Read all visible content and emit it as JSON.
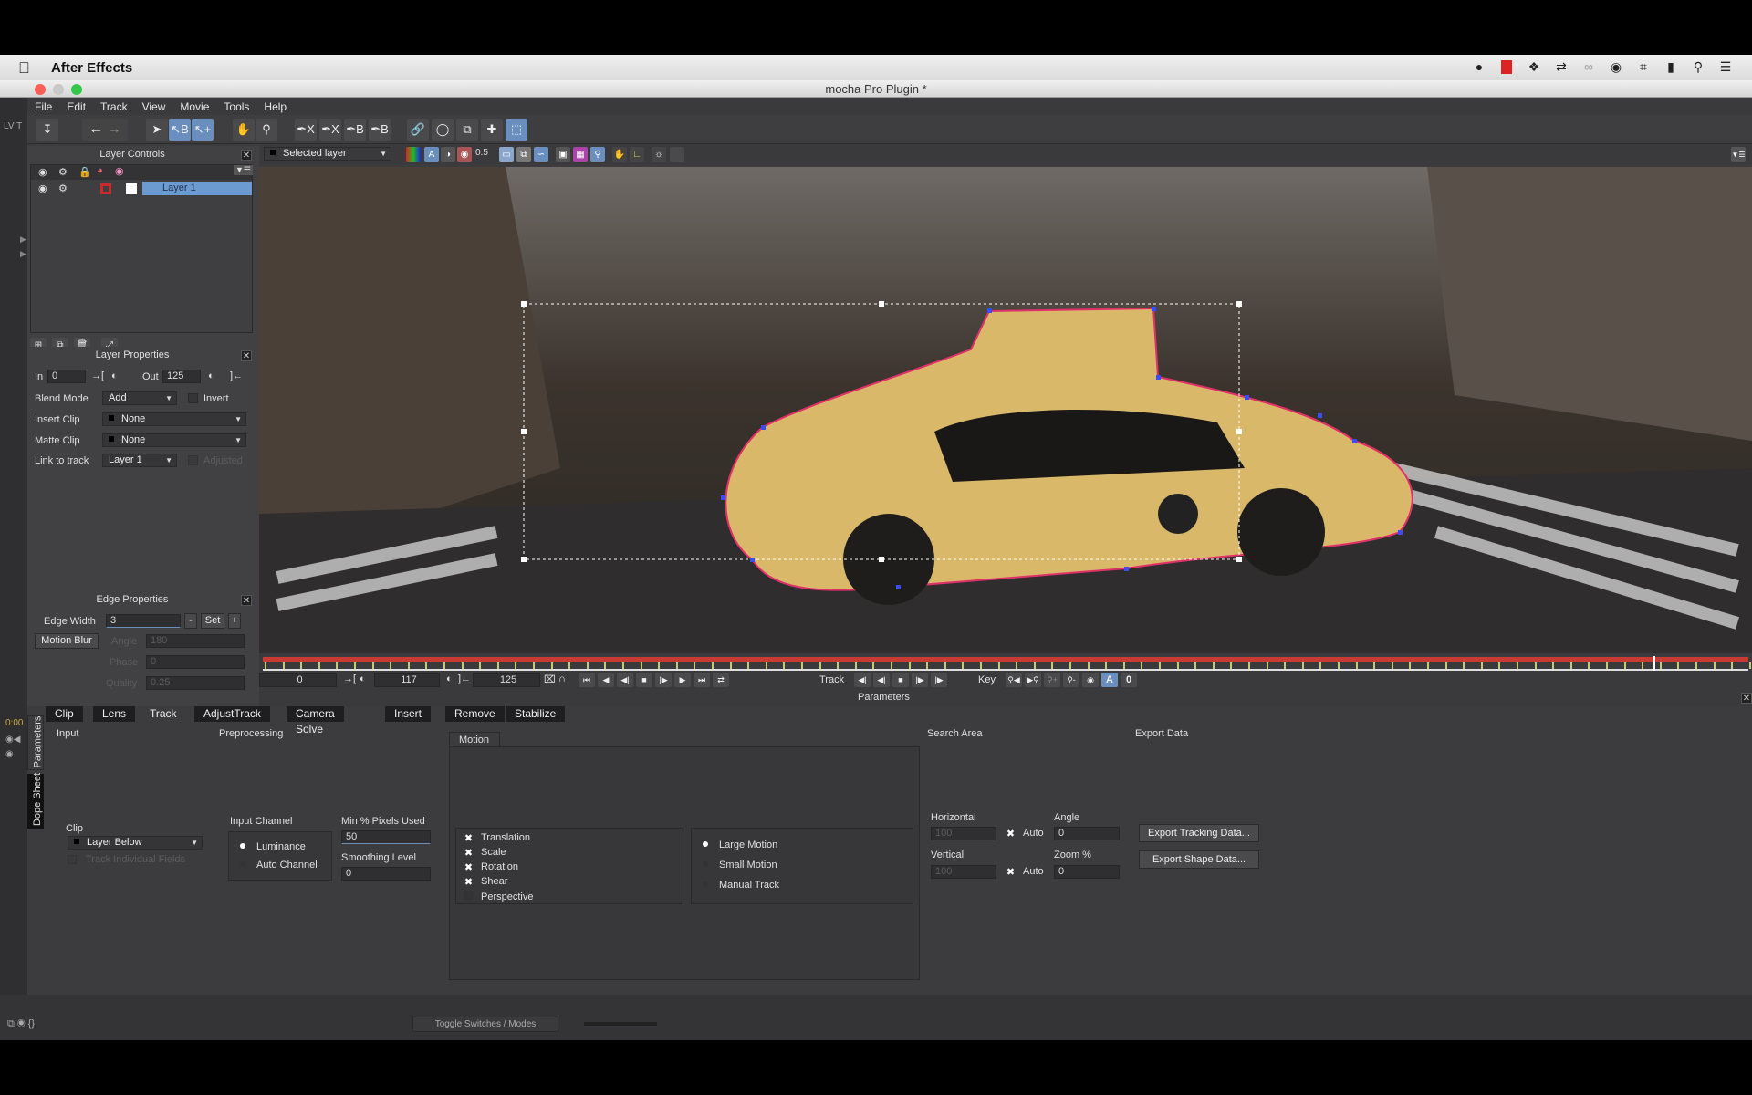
{
  "mac_menubar": {
    "app_name": "After Effects",
    "tray_icons": [
      "notification-icon",
      "record-icon",
      "dropbox-icon",
      "sync-icon",
      "creative-cloud-icon",
      "target-icon",
      "wifi-icon",
      "battery-icon",
      "spotlight-icon",
      "list-icon"
    ]
  },
  "window": {
    "title": "mocha Pro Plugin *",
    "ae_left_label": "LV T"
  },
  "menu": [
    "File",
    "Edit",
    "Track",
    "View",
    "Movie",
    "Tools",
    "Help"
  ],
  "toolbar": {
    "tools": [
      "save-icon",
      "undo-icon",
      "redo-icon",
      "pick-icon",
      "select-b-icon",
      "add-point-icon",
      "hand-icon",
      "zoom-icon",
      "xspline-icon",
      "xspline-add-icon",
      "bezier-icon",
      "bezier-add-icon",
      "link-icon",
      "lasso-icon",
      "transform-icon",
      "move-icon",
      "surface-icon"
    ]
  },
  "viewer_bar": {
    "layer_select": "Selected layer",
    "opacity": "0.5"
  },
  "layer_controls": {
    "title": "Layer Controls",
    "layers": [
      {
        "name": "Layer 1",
        "color": "#cc2a2a"
      }
    ]
  },
  "layer_properties": {
    "title": "Layer Properties",
    "in_label": "In",
    "in_value": "0",
    "out_label": "Out",
    "out_value": "125",
    "blend_mode_label": "Blend Mode",
    "blend_mode": "Add",
    "invert_label": "Invert",
    "insert_clip_label": "Insert Clip",
    "insert_clip": "None",
    "matte_clip_label": "Matte Clip",
    "matte_clip": "None",
    "link_to_track_label": "Link to track",
    "link_to_track": "Layer 1",
    "adjusted_label": "Adjusted"
  },
  "edge_properties": {
    "title": "Edge Properties",
    "edge_width_label": "Edge Width",
    "edge_width": "3",
    "minus": "-",
    "set": "Set",
    "plus": "+",
    "motion_blur": "Motion Blur",
    "angle_label": "Angle",
    "angle": "180",
    "phase_label": "Phase",
    "phase": "0",
    "quality_label": "Quality",
    "quality": "0.25"
  },
  "timeline": {
    "start": "0",
    "current": "117",
    "end": "125",
    "progress_percent": 93.6,
    "track_label": "Track",
    "key_label": "Key",
    "parameters_label": "Parameters"
  },
  "params": {
    "side_tabs": [
      "Parameters",
      "Dope Sheet"
    ],
    "tabs": [
      "Clip",
      "Lens",
      "Track",
      "AdjustTrack",
      "Camera Solve",
      "Insert",
      "Remove",
      "Stabilize"
    ],
    "active_tab": "Track",
    "input": {
      "title": "Input",
      "clip_label": "Clip",
      "clip": "Layer Below",
      "track_fields": "Track Individual Fields"
    },
    "preprocessing": {
      "title": "Preprocessing",
      "input_channel_label": "Input Channel",
      "luminance": "Luminance",
      "auto_channel": "Auto Channel",
      "min_pixels_label": "Min % Pixels Used",
      "min_pixels": "50",
      "smoothing_label": "Smoothing Level",
      "smoothing": "0"
    },
    "motion": {
      "title": "Motion",
      "checks": [
        {
          "label": "Translation",
          "checked": true
        },
        {
          "label": "Scale",
          "checked": true
        },
        {
          "label": "Rotation",
          "checked": true
        },
        {
          "label": "Shear",
          "checked": true
        },
        {
          "label": "Perspective",
          "checked": false
        }
      ],
      "modes": [
        {
          "label": "Large Motion",
          "selected": true
        },
        {
          "label": "Small Motion",
          "selected": false
        },
        {
          "label": "Manual Track",
          "selected": false
        }
      ]
    },
    "search_area": {
      "title": "Search Area",
      "horizontal_label": "Horizontal",
      "horizontal": "100",
      "vertical_label": "Vertical",
      "vertical": "100",
      "auto": "Auto",
      "angle_label": "Angle",
      "angle": "0",
      "zoom_label": "Zoom %",
      "zoom": "0"
    },
    "export": {
      "title": "Export Data",
      "tracking": "Export Tracking Data...",
      "shape": "Export Shape Data..."
    }
  },
  "status": {
    "toggle": "Toggle Switches / Modes",
    "timecode": "0:00"
  }
}
